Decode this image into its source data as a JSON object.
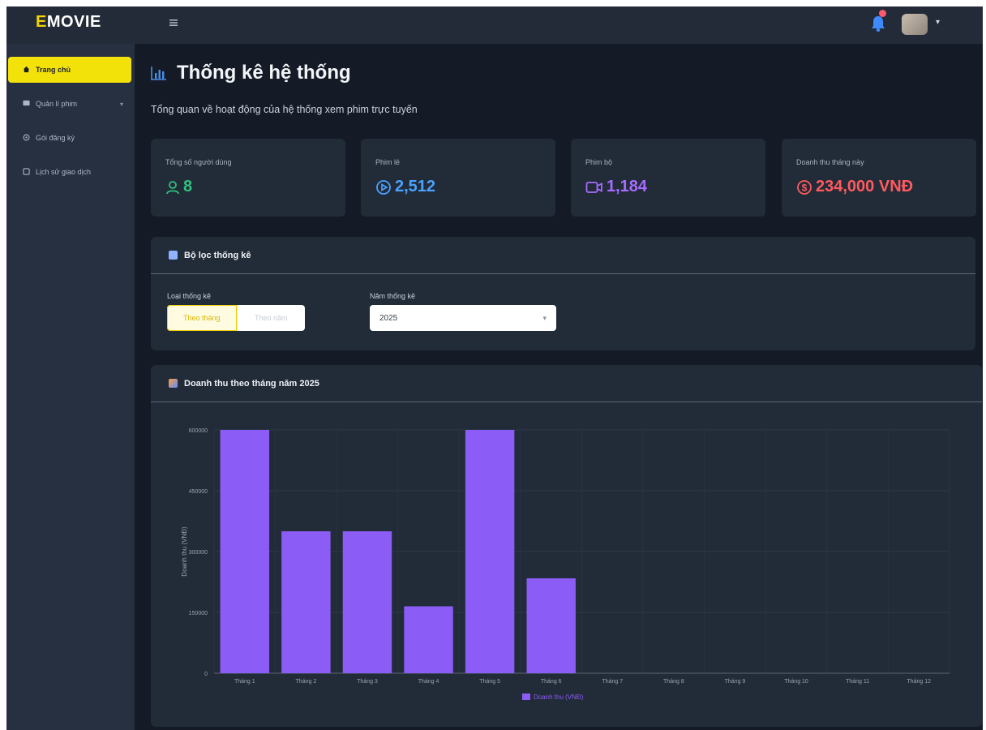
{
  "brand": {
    "prefix": "E",
    "rest": "MOVIE"
  },
  "sidebar": {
    "items": [
      {
        "label": "Trang chủ",
        "icon": "home-icon",
        "active": true
      },
      {
        "label": "Quản lí phim",
        "icon": "film-icon",
        "has_chevron": true
      },
      {
        "label": "Gói đăng ký",
        "icon": "package-icon"
      },
      {
        "label": "Lịch sử giao dịch",
        "icon": "history-icon"
      }
    ]
  },
  "page": {
    "title": "Thống kê hệ thống",
    "subtitle": "Tổng quan về hoạt động của hệ thống xem phim trực tuyến"
  },
  "stats": [
    {
      "label": "Tổng số người dùng",
      "value": "8",
      "color": "#2ec27e",
      "icon": "user-icon"
    },
    {
      "label": "Phim lẻ",
      "value": "2,512",
      "color": "#4aa3ff",
      "icon": "play-circle-icon"
    },
    {
      "label": "Phim bộ",
      "value": "1,184",
      "color": "#a66cff",
      "icon": "video-camera-icon"
    },
    {
      "label": "Doanh thu tháng này",
      "value": "234,000 VNĐ",
      "color": "#ff5a5f",
      "icon": "coin-icon"
    }
  ],
  "filter": {
    "title": "Bộ lọc thống kê",
    "type_label": "Loại thống kê",
    "type_options": [
      "Theo tháng",
      "Theo năm"
    ],
    "year_label": "Năm thống kê",
    "year_value": "2025"
  },
  "chart_panel": {
    "title": "Doanh thu theo tháng năm 2025"
  },
  "chart_data": {
    "type": "bar",
    "categories": [
      "Tháng 1",
      "Tháng 2",
      "Tháng 3",
      "Tháng 4",
      "Tháng 5",
      "Tháng 6",
      "Tháng 7",
      "Tháng 8",
      "Tháng 9",
      "Tháng 10",
      "Tháng 11",
      "Tháng 12"
    ],
    "series": [
      {
        "name": "Doanh thu (VNĐ)",
        "values": [
          600000,
          350000,
          350000,
          165000,
          600000,
          234000,
          0,
          0,
          0,
          0,
          0,
          0
        ],
        "color": "#8b5cf6"
      }
    ],
    "xlabel": "",
    "ylabel": "Doanh thu (VNĐ)",
    "ylim": [
      0,
      600000
    ],
    "yticks": [
      0,
      150000,
      300000,
      450000,
      600000
    ],
    "ytick_labels": [
      "0",
      "150000",
      "300000",
      "450000",
      "600000"
    ],
    "grid": true,
    "legend": "bottom"
  },
  "colors": {
    "accent": "#f2e20a",
    "bar": "#8b5cf6"
  }
}
